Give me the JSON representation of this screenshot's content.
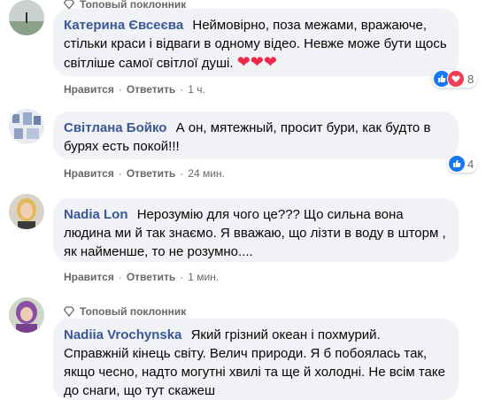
{
  "comments": [
    {
      "badge": "Топовый поклонник",
      "author": "Катерина Євсеєва",
      "text": "Неймовірно, поза межами, вражаюче, стільки краси і відваги в одному відео. Невже може бути щось світліше самої світлої душі.",
      "hearts": "❤❤❤",
      "like": "Нравится",
      "reply": "Ответить",
      "time": "1 ч.",
      "reaction_count": "8",
      "reaction_icons": [
        "like-icon",
        "love-icon"
      ]
    },
    {
      "author": "Світлана Бойко",
      "text": "А он, мятежный, просит бури, как будто в бурях есть покой!!!",
      "like": "Нравится",
      "reply": "Ответить",
      "time": "24 мин.",
      "reaction_count": "4",
      "reaction_icons": [
        "like-icon"
      ]
    },
    {
      "author": "Nadia Lon",
      "text": "Нерозумію для чого це??? Що сильна вона людина ми й так знаємо. Я вважаю, що лізти в воду в шторм , як найменше, то не розумно....",
      "like": "Нравится",
      "reply": "Ответить",
      "time": "1 мин."
    },
    {
      "badge": "Топовый поклонник",
      "author": "Nadiia Vrochynska",
      "text": "Який грізний океан і похмурий. Справжній кінець світу. Велич природи. Я б побоялась так, якщо чесно, надто могутні хвилі та ще й холодні. Не всім таке до снаги, що тут скажеш"
    }
  ],
  "colors": {
    "name": "#385898",
    "bubble": "#f0f2f5",
    "meta": "#65676b",
    "like": "#1877f2",
    "love": "#f33e58"
  }
}
